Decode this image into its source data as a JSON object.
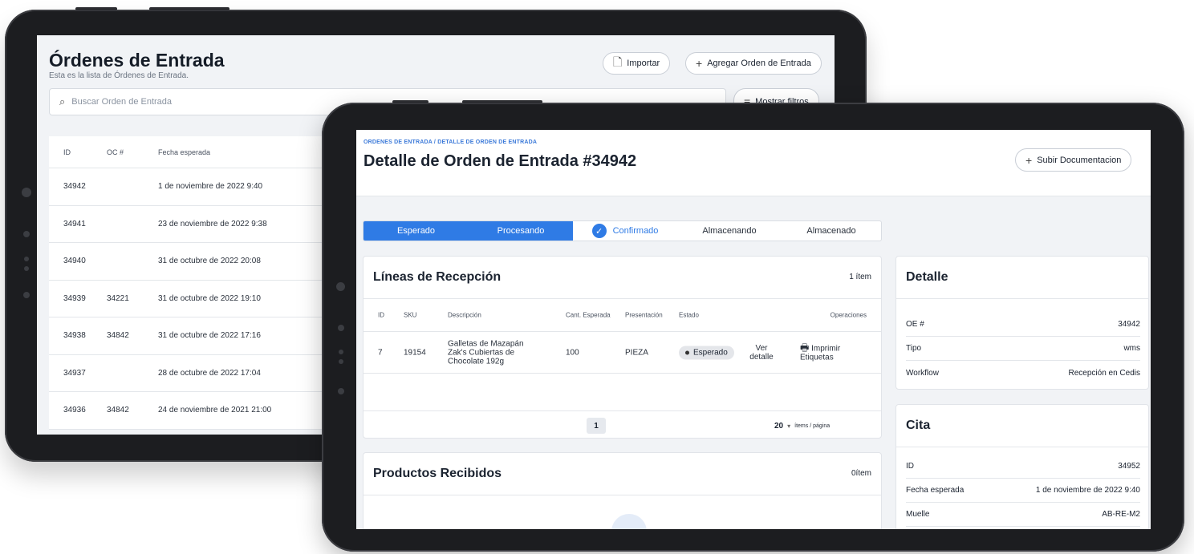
{
  "back": {
    "title": "Órdenes de Entrada",
    "subtitle": "Esta es la lista de Órdenes de Entrada.",
    "import_label": "Importar",
    "add_label": "Agregar Orden de Entrada",
    "search_placeholder": "Buscar Orden de Entrada",
    "filters_label": "Mostrar filtros",
    "columns": [
      "ID",
      "OC #",
      "Fecha esperada"
    ],
    "rows": [
      {
        "id": "34942",
        "oc": "",
        "date": "1 de noviembre de 2022 9:40"
      },
      {
        "id": "34941",
        "oc": "",
        "date": "23 de noviembre de 2022 9:38"
      },
      {
        "id": "34940",
        "oc": "",
        "date": "31 de octubre de 2022 20:08"
      },
      {
        "id": "34939",
        "oc": "34221",
        "date": "31 de octubre de 2022 19:10"
      },
      {
        "id": "34938",
        "oc": "34842",
        "date": "31 de octubre de 2022 17:16"
      },
      {
        "id": "34937",
        "oc": "",
        "date": "28 de octubre de 2022 17:04"
      },
      {
        "id": "34936",
        "oc": "34842",
        "date": "24 de noviembre de 2021 21:00"
      }
    ]
  },
  "front": {
    "breadcrumb": "ORDENES DE ENTRADA / DETALLE DE ORDEN DE ENTRADA",
    "title": "Detalle de Orden de Entrada #34942",
    "upload_label": "Subir Documentacion",
    "steps": [
      "Esperado",
      "Procesando",
      "Confirmado",
      "Almacenando",
      "Almacenado"
    ],
    "lines": {
      "title": "Líneas de Recepción",
      "count": "1 ítem",
      "columns": [
        "ID",
        "SKU",
        "Descripción",
        "Cant. Esperada",
        "Presentación",
        "Estado",
        "Operaciones"
      ],
      "row": {
        "id": "7",
        "sku": "19154",
        "description": "Galletas de Mazapán Zak's Cubiertas de Chocolate 192g",
        "qty": "100",
        "presentation": "PIEZA",
        "status": "Esperado",
        "view_label": "Ver detalle",
        "print_label": "Imprimir Etiquetas"
      },
      "page": "1",
      "per_page": "20",
      "per_page_label": "ítems / página"
    },
    "products": {
      "title": "Productos Recibidos",
      "count": "0ítem"
    },
    "detail": {
      "title": "Detalle",
      "items": [
        {
          "label": "OE #",
          "value": "34942"
        },
        {
          "label": "Tipo",
          "value": "wms"
        },
        {
          "label": "Workflow",
          "value": "Recepción en Cedis"
        }
      ]
    },
    "cita": {
      "title": "Cita",
      "items": [
        {
          "label": "ID",
          "value": "34952"
        },
        {
          "label": "Fecha esperada",
          "value": "1 de noviembre de 2022 9:40"
        },
        {
          "label": "Muelle",
          "value": "AB-RE-M2"
        }
      ]
    }
  },
  "colors": {
    "accent": "#2f7be5",
    "device": "#1c1d20",
    "screen_bg": "#f1f3f6"
  }
}
